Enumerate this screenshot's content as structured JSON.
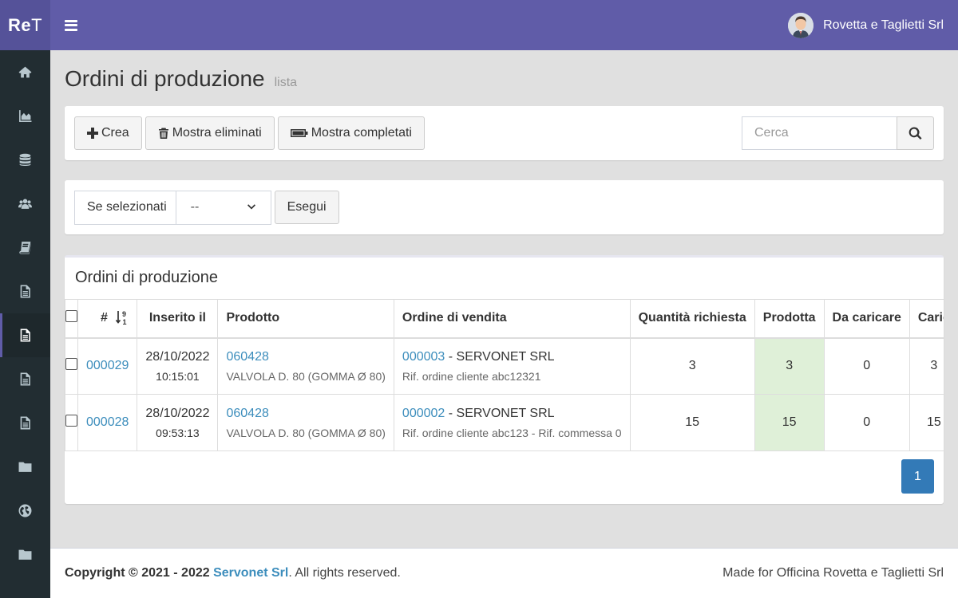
{
  "brand": {
    "logo_main": "Re",
    "logo_tail": "T"
  },
  "header": {
    "user_name": "Rovetta e Taglietti Srl"
  },
  "sidebar": {
    "items": [
      {
        "icon": "home-icon",
        "active": false
      },
      {
        "icon": "area-chart-icon",
        "active": false
      },
      {
        "icon": "database-icon",
        "active": false
      },
      {
        "icon": "users-icon",
        "active": false
      },
      {
        "icon": "book-icon",
        "active": false
      },
      {
        "icon": "file-text-icon",
        "active": false
      },
      {
        "icon": "file-text-icon",
        "active": true
      },
      {
        "icon": "file-text-icon",
        "active": false
      },
      {
        "icon": "file-text-icon",
        "active": false
      },
      {
        "icon": "folder-icon",
        "active": false
      },
      {
        "icon": "globe-icon",
        "active": false
      },
      {
        "icon": "folder-icon",
        "active": false
      }
    ]
  },
  "page": {
    "title": "Ordini di produzione",
    "subtitle": "lista"
  },
  "toolbar": {
    "create_label": "Crea",
    "show_deleted_label": "Mostra eliminati",
    "show_completed_label": "Mostra completati",
    "search_placeholder": "Cerca"
  },
  "bulk": {
    "label": "Se selezionati",
    "selected": "--",
    "run_label": "Esegui"
  },
  "list": {
    "title": "Ordini di produzione",
    "columns": {
      "num": "#",
      "inserted": "Inserito il",
      "product": "Prodotto",
      "sales_order": "Ordine di vendita",
      "qty_requested": "Quantità richiesta",
      "produced": "Prodotta",
      "to_load": "Da caricare",
      "loaded": "Caric"
    },
    "rows": [
      {
        "num": "000029",
        "date": "28/10/2022",
        "time": "10:15:01",
        "product_code": "060428",
        "product_desc": "VALVOLA D. 80 (GOMMA Ø 80)",
        "order_code": "000003",
        "order_customer": " - SERVONET SRL",
        "order_ref": "Rif. ordine cliente abc12321",
        "qty_requested": "3",
        "produced": "3",
        "to_load": "0",
        "loaded": "3"
      },
      {
        "num": "000028",
        "date": "28/10/2022",
        "time": "09:53:13",
        "product_code": "060428",
        "product_desc": "VALVOLA D. 80 (GOMMA Ø 80)",
        "order_code": "000002",
        "order_customer": " - SERVONET SRL",
        "order_ref": "Rif. ordine cliente abc123 - Rif. commessa 0",
        "qty_requested": "15",
        "produced": "15",
        "to_load": "0",
        "loaded": "15"
      }
    ],
    "pagination": {
      "current_page": "1"
    }
  },
  "footer": {
    "copyright_prefix": "Copyright © 2021 - 2022 ",
    "company": "Servonet Srl",
    "rights": ". All rights reserved.",
    "made_for": "Made for Officina Rovetta e Taglietti Srl"
  },
  "colors": {
    "brand": "#605ca8",
    "sidebar": "#222d32",
    "link": "#3c8dbc",
    "produced_bg": "#dff0d8",
    "pager": "#337ab7"
  }
}
